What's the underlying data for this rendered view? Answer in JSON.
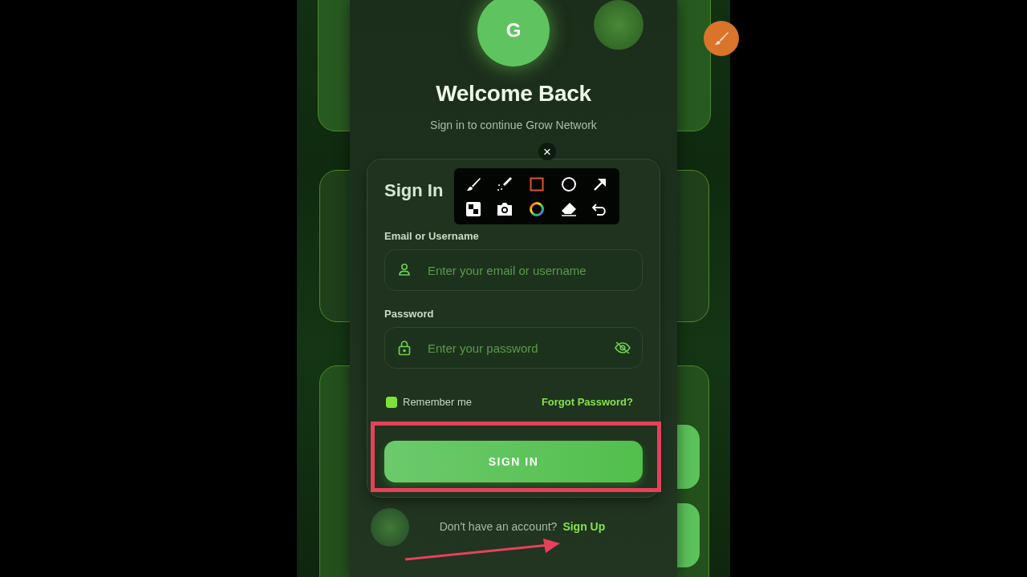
{
  "logo": {
    "letter": "G"
  },
  "title": "Welcome Back",
  "subtitle": "Sign in to continue Grow Network",
  "close": "×",
  "form": {
    "heading": "Sign In",
    "fields": [
      {
        "label": "Email or Username",
        "placeholder": "Enter your email or username",
        "kind": "text"
      },
      {
        "label": "Password",
        "placeholder": "Enter your password",
        "kind": "password"
      }
    ],
    "remember": {
      "label": "Remember me",
      "checked": true
    },
    "forgot": "Forgot Password?",
    "submit": "SIGN IN"
  },
  "footer": {
    "prompt": "Don't have an account?",
    "link": "Sign Up"
  }
}
